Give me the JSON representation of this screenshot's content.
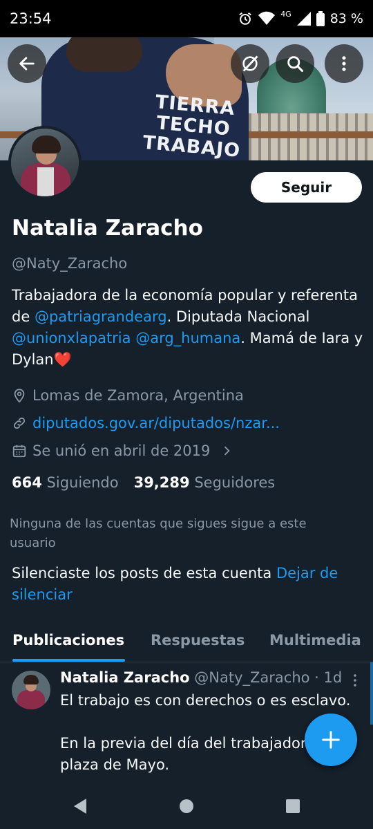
{
  "status_bar": {
    "time": "23:54",
    "network": "4G",
    "battery": "83 %",
    "icons": [
      "alarm-icon",
      "wifi-icon",
      "signal-icon",
      "battery-icon"
    ]
  },
  "banner": {
    "shirt_text_line1": "TIERRA",
    "shirt_text_line2": "TECHO",
    "shirt_text_line3": "TRABAJO",
    "buttons": [
      "back-arrow-icon",
      "grok-icon",
      "search-icon",
      "more-vertical-icon"
    ]
  },
  "profile": {
    "follow_label": "Seguir",
    "name": "Natalia Zaracho",
    "handle": "@Naty_Zaracho",
    "bio": {
      "part1": "Trabajadora de la economía popular y referenta de ",
      "mention1": "@patriagrandearg",
      "part2": ". Diputada Nacional ",
      "mention2": "@unionxlapatria",
      "part3": " ",
      "mention3": "@arg_humana",
      "part4": ". Mamá de Iara y Dylan",
      "emoji": "❤️"
    },
    "location": "Lomas de Zamora, Argentina",
    "website": "diputados.gov.ar/diputados/nzar...",
    "joined": "Se unió en abril de 2019",
    "following_count": "664",
    "following_label": "Siguiendo",
    "followers_count": "39,289",
    "followers_label": "Seguidores",
    "no_mutual_followers": "Ninguna de las cuentas que sigues sigue a este usuario",
    "muted_text": "Silenciaste los posts de esta cuenta ",
    "unmute_link": "Dejar de silenciar"
  },
  "tabs": [
    {
      "label": "Publicaciones",
      "active": true
    },
    {
      "label": "Respuestas",
      "active": false
    },
    {
      "label": "Multimedia",
      "active": false
    }
  ],
  "post": {
    "author": "Natalia Zaracho",
    "handle_time": "@Naty_Zaracho · 1d",
    "line1": "El trabajo es con derechos o es esclavo.",
    "line2": "En la previa del día del trabajador, en plaza de Mayo."
  },
  "colors": {
    "background": "#15202b",
    "accent": "#1d9bf0",
    "secondary_text": "#8b98a5"
  }
}
